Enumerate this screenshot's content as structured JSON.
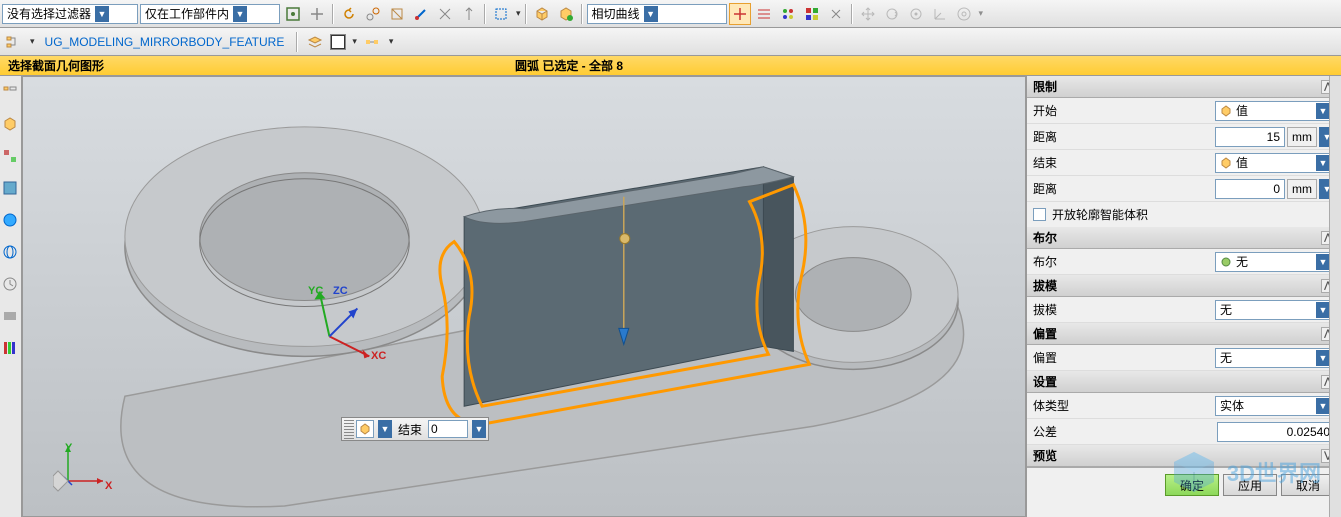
{
  "toolbar": {
    "filter_dropdown": "没有选择过滤器",
    "scope_dropdown": "仅在工作部件内",
    "curve_dropdown": "相切曲线",
    "feature_label": "UG_MODELING_MIRRORBODY_FEATURE"
  },
  "status": {
    "left": "选择截面几何图形",
    "center": "圆弧 已选定 - 全部 8"
  },
  "floating": {
    "label": "结束",
    "value": "0"
  },
  "panel": {
    "sections": {
      "limits": "限制",
      "boolean": "布尔",
      "draft": "拔模",
      "offset": "偏置",
      "settings": "设置",
      "preview": "预览"
    },
    "start_label": "开始",
    "start_value": "值",
    "distance_label": "距离",
    "distance1_value": "15",
    "end_label": "结束",
    "end_value": "值",
    "distance2_value": "0",
    "unit": "mm",
    "open_profile_label": "开放轮廓智能体积",
    "boolean_label": "布尔",
    "boolean_value": "无",
    "draft_label": "拔模",
    "draft_value": "无",
    "offset_label": "偏置",
    "offset_value": "无",
    "body_type_label": "体类型",
    "body_type_value": "实体",
    "tolerance_label": "公差",
    "tolerance_value": "0.02540",
    "preview_label": "预览",
    "ok": "确定",
    "apply": "应用",
    "cancel": "取消"
  },
  "axes": {
    "xc": "XC",
    "yc": "YC",
    "zc": "ZC",
    "x": "X",
    "y": "Y"
  },
  "watermark": "3D世界网"
}
